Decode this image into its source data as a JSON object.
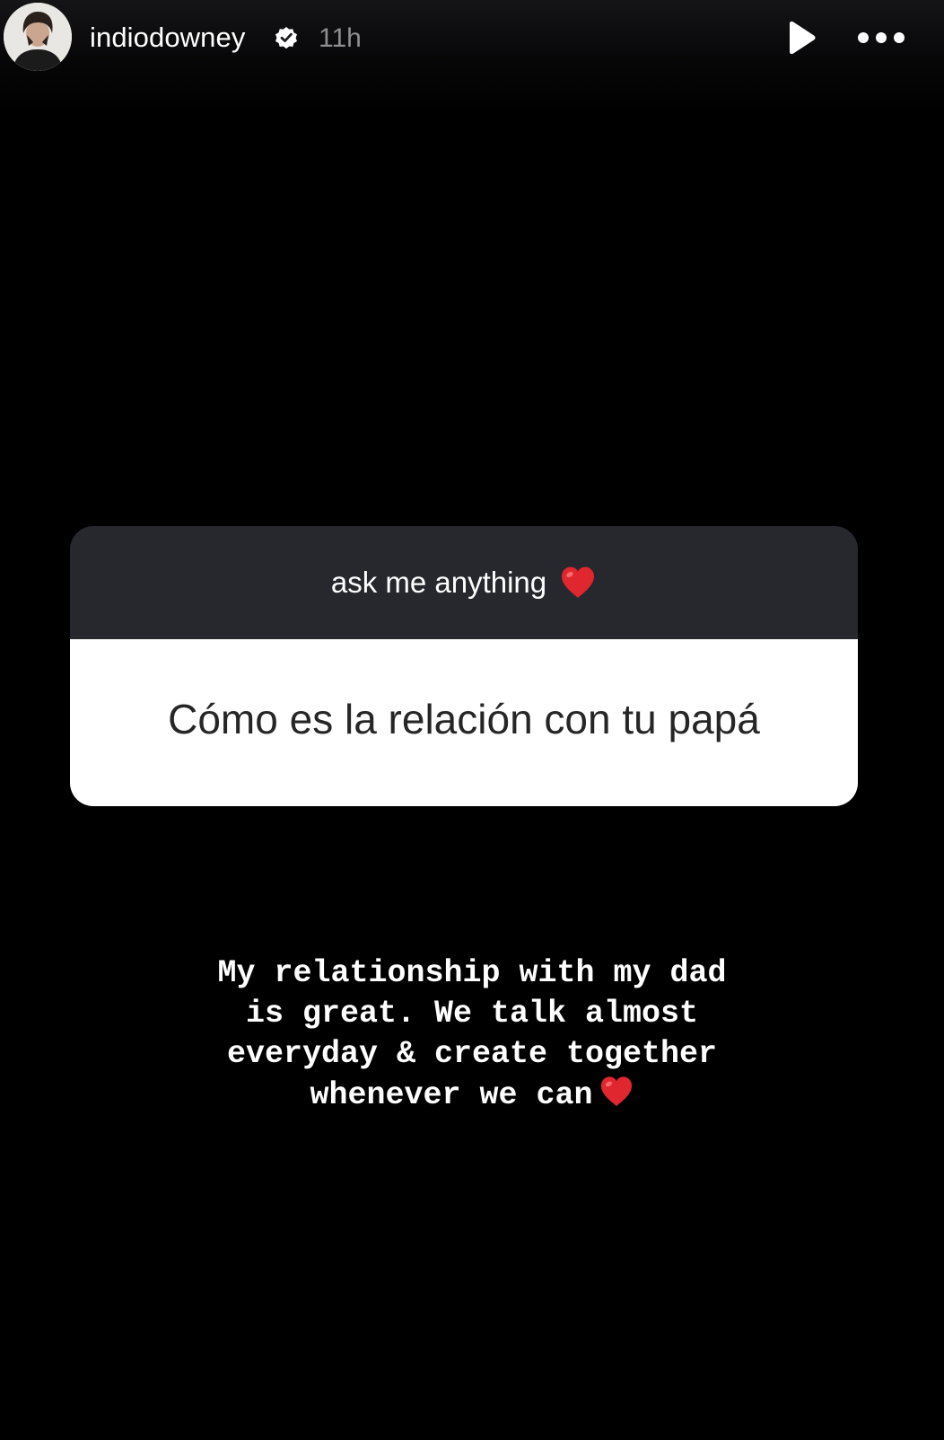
{
  "header": {
    "username": "indiodowney",
    "verified_icon": "verified-badge-icon",
    "timestamp": "11h",
    "play_icon": "play-icon",
    "more_icon": "more-options-icon"
  },
  "question_sticker": {
    "prompt": "ask me anything",
    "prompt_emoji": "red-heart-icon",
    "question": "Cómo es la relación con tu papá",
    "header_color": "#26282d",
    "body_color": "#ffffff"
  },
  "answer": {
    "lines": [
      "My relationship with my dad",
      "is great. We talk almost",
      "everyday & create together",
      "whenever we can"
    ],
    "trailing_emoji": "red-heart-icon"
  },
  "colors": {
    "background": "#000000",
    "heart": "#e0262e",
    "timestamp": "#8e8e93"
  }
}
